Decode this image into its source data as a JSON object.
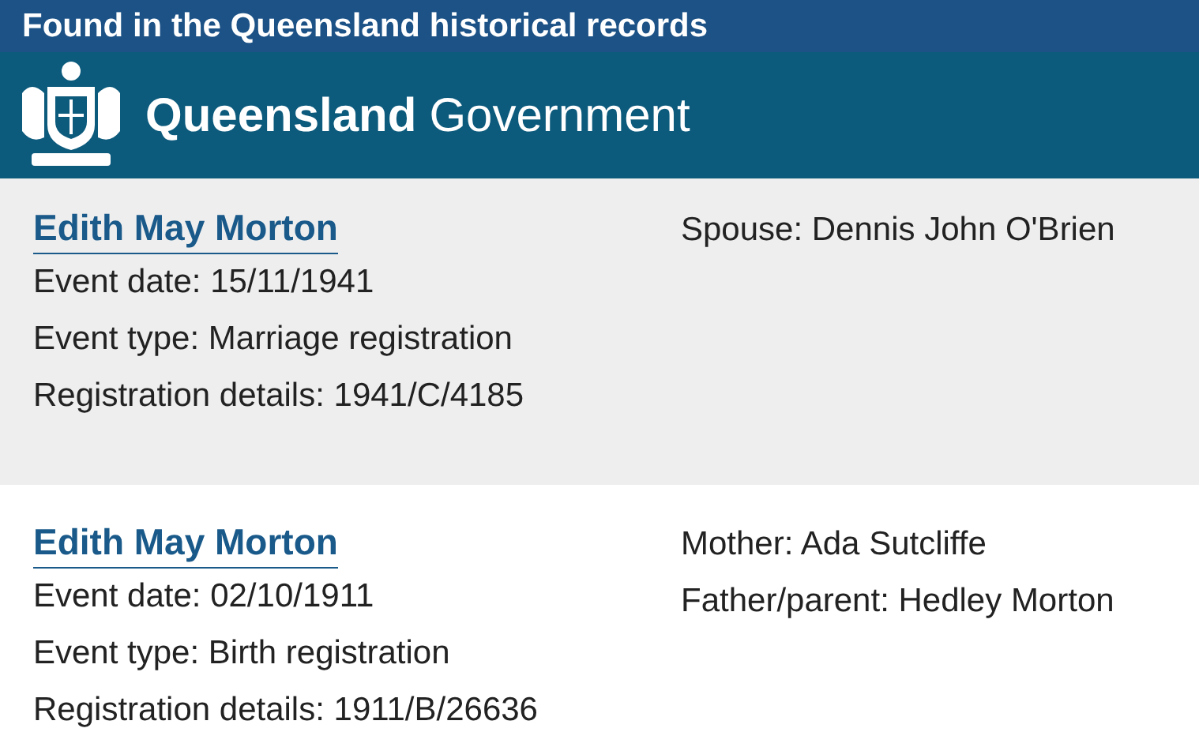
{
  "banner": {
    "title": "Found in the Queensland historical records"
  },
  "header": {
    "brand_bold": "Queensland",
    "brand_rest": "Government"
  },
  "records": [
    {
      "name": "Edith May Morton",
      "highlighted": true,
      "details": [
        "Event date: 15/11/1941",
        "Event type: Marriage registration",
        "Registration details: 1941/C/4185"
      ],
      "relations": [
        "Spouse: Dennis John O'Brien"
      ]
    },
    {
      "name": "Edith May Morton",
      "highlighted": false,
      "details": [
        "Event date: 02/10/1911",
        "Event type: Birth registration",
        "Registration details: 1911/B/26636"
      ],
      "relations": [
        "Mother: Ada Sutcliffe",
        "Father/parent: Hedley Morton"
      ]
    }
  ]
}
